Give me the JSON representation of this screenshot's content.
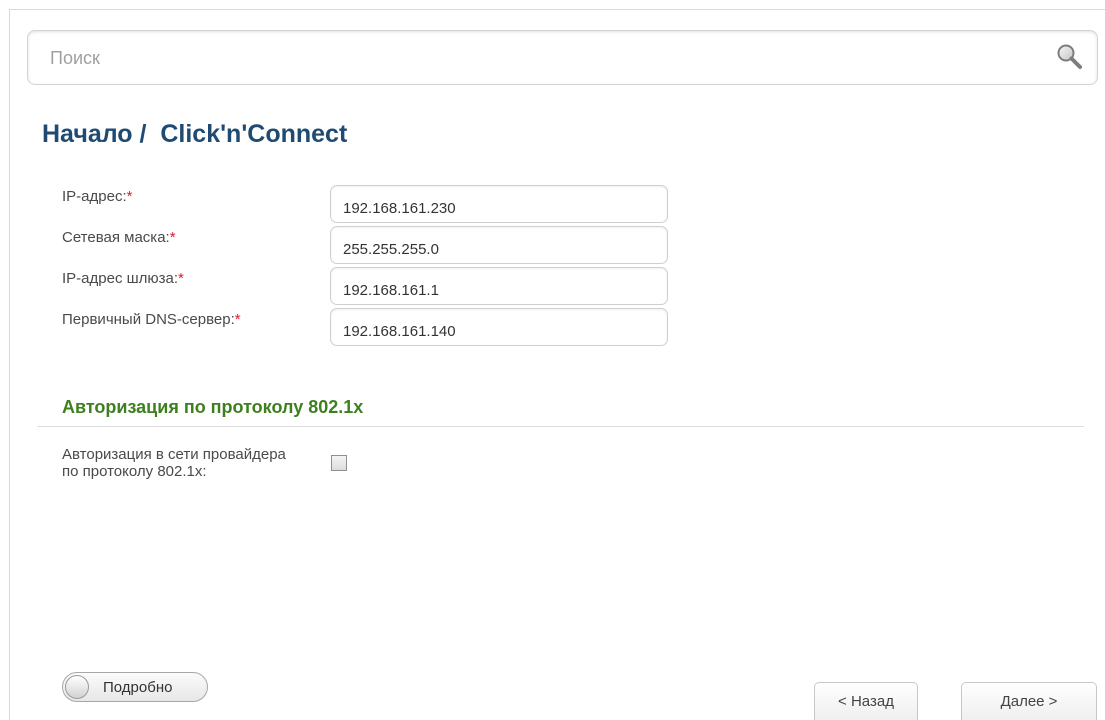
{
  "search": {
    "placeholder": "Поиск",
    "value": ""
  },
  "page": {
    "title": "Начало /  Click'n'Connect"
  },
  "fields": [
    {
      "label": "IP-адрес:",
      "required_mark": "*",
      "value": "192.168.161.230"
    },
    {
      "label": "Сетевая маска:",
      "required_mark": "*",
      "value": "255.255.255.0"
    },
    {
      "label": "IP-адрес шлюза:",
      "required_mark": "*",
      "value": "192.168.161.1"
    },
    {
      "label": "Первичный DNS-сервер:",
      "required_mark": "*",
      "value": "192.168.161.140"
    }
  ],
  "auth_section": {
    "title": "Авторизация по протоколу 802.1x",
    "checkbox_label": "Авторизация в сети провайдера по протоколу 802.1x:",
    "checked": false
  },
  "footer": {
    "details_toggle_label": "Подробно",
    "details_toggle_on": false,
    "back_label": "< Назад",
    "next_label": "Далее >"
  },
  "colors": {
    "title": "#1f4b73",
    "section_title": "#3e8020",
    "required": "#e0182d"
  },
  "icons": {
    "search": "magnifier-icon"
  }
}
